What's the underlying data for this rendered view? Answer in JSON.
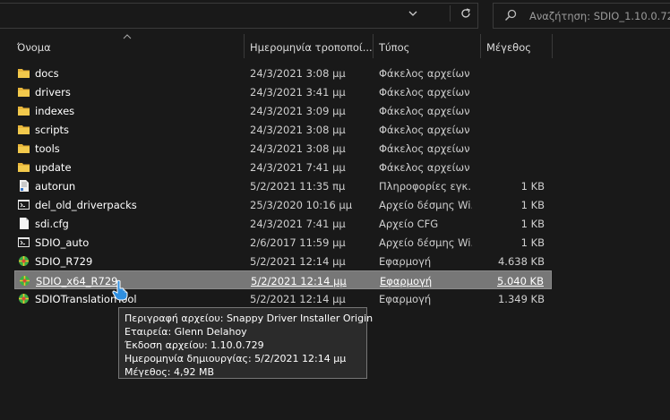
{
  "toolbar": {
    "search_placeholder": "Αναζήτηση: SDIO_1.10.0.729"
  },
  "columns": {
    "name": "Όνομα",
    "date": "Ημερομηνία τροποποί...",
    "type": "Τύπος",
    "size": "Μέγεθος"
  },
  "files": [
    {
      "name": "docs",
      "date": "24/3/2021 3:08 μμ",
      "type": "Φάκελος αρχείων",
      "size": "",
      "icon": "folder-icon"
    },
    {
      "name": "drivers",
      "date": "24/3/2021 3:41 μμ",
      "type": "Φάκελος αρχείων",
      "size": "",
      "icon": "folder-icon"
    },
    {
      "name": "indexes",
      "date": "24/3/2021 3:09 μμ",
      "type": "Φάκελος αρχείων",
      "size": "",
      "icon": "folder-icon"
    },
    {
      "name": "scripts",
      "date": "24/3/2021 3:08 μμ",
      "type": "Φάκελος αρχείων",
      "size": "",
      "icon": "folder-icon"
    },
    {
      "name": "tools",
      "date": "24/3/2021 3:08 μμ",
      "type": "Φάκελος αρχείων",
      "size": "",
      "icon": "folder-icon"
    },
    {
      "name": "update",
      "date": "24/3/2021 7:41 μμ",
      "type": "Φάκελος αρχείων",
      "size": "",
      "icon": "folder-icon"
    },
    {
      "name": "autorun",
      "date": "5/2/2021 11:35 πμ",
      "type": "Πληροφορίες εγκ...",
      "size": "1 KB",
      "icon": "setup-info-icon"
    },
    {
      "name": "del_old_driverpacks",
      "date": "25/3/2020 10:16 μμ",
      "type": "Αρχείο δέσμης Wi...",
      "size": "1 KB",
      "icon": "batch-file-icon"
    },
    {
      "name": "sdi.cfg",
      "date": "24/3/2021 7:41 μμ",
      "type": "Αρχείο CFG",
      "size": "1 KB",
      "icon": "document-icon"
    },
    {
      "name": "SDIO_auto",
      "date": "2/6/2017 11:59 μμ",
      "type": "Αρχείο δέσμης Wi...",
      "size": "1 KB",
      "icon": "batch-file-icon"
    },
    {
      "name": "SDIO_R729",
      "date": "5/2/2021 12:14 μμ",
      "type": "Εφαρμογή",
      "size": "4.638 KB",
      "icon": "app-icon"
    },
    {
      "name": "SDIO_x64_R729",
      "date": "5/2/2021 12:14 μμ",
      "type": "Εφαρμογή",
      "size": "5.040 KB",
      "icon": "app-icon"
    },
    {
      "name": "SDIOTranslationTool",
      "date": "5/2/2021 12:14 μμ",
      "type": "Εφαρμογή",
      "size": "1.349 KB",
      "icon": "app-icon"
    }
  ],
  "selected_index": 11,
  "tooltip": {
    "lines": [
      "Περιγραφή αρχείου: Snappy Driver Installer Origin",
      "Εταιρεία: Glenn Delahoy",
      "Έκδοση αρχείου: 1.10.0.729",
      "Ημερομηνία δημιουργίας: 5/2/2021 12:14 μμ",
      "Μέγεθος: 4,92 MB"
    ]
  },
  "colors": {
    "background": "#191919",
    "folder": "#e8b53a",
    "selection": "#777777"
  }
}
